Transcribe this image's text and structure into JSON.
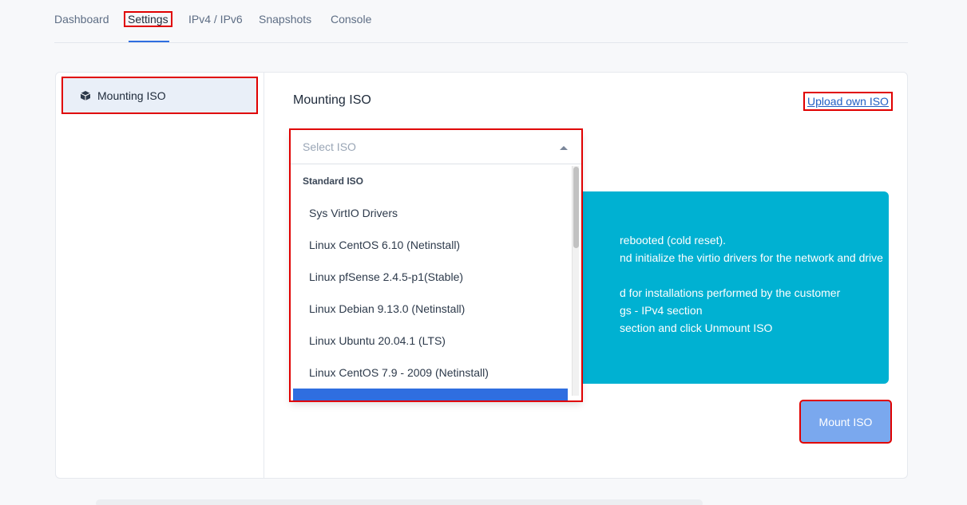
{
  "tabs": [
    {
      "label": "Dashboard"
    },
    {
      "label": "Settings"
    },
    {
      "label": "IPv4 / IPv6"
    },
    {
      "label": "Snapshots"
    },
    {
      "label": "Console"
    }
  ],
  "sidebar": {
    "items": [
      {
        "label": "Mounting ISO",
        "icon": "cube-icon"
      }
    ]
  },
  "main": {
    "title": "Mounting ISO",
    "upload_link": "Upload own ISO",
    "mount_button": "Mount ISO"
  },
  "select": {
    "placeholder": "Select ISO",
    "group_label": "Standard ISO",
    "options": [
      "Sys VirtIO Drivers",
      "Linux CentOS 6.10 (Netinstall)",
      "Linux pfSense 2.4.5-p1(Stable)",
      "Linux Debian 9.13.0 (Netinstall)",
      "Linux Ubuntu 20.04.1 (LTS)",
      "Linux CentOS 7.9 - 2009 (Netinstall)"
    ]
  },
  "info": {
    "lines": [
      "rebooted (cold reset).",
      "nd initialize the virtio drivers for the network and drive",
      "d for installations performed by the customer",
      "gs - IPv4 section",
      "section and click Unmount ISO"
    ]
  },
  "colors": {
    "accent": "#2f6ee0",
    "info_bg": "#00b1d2",
    "mount_button_bg": "#7aa8ee",
    "annotation": "#e00000"
  }
}
